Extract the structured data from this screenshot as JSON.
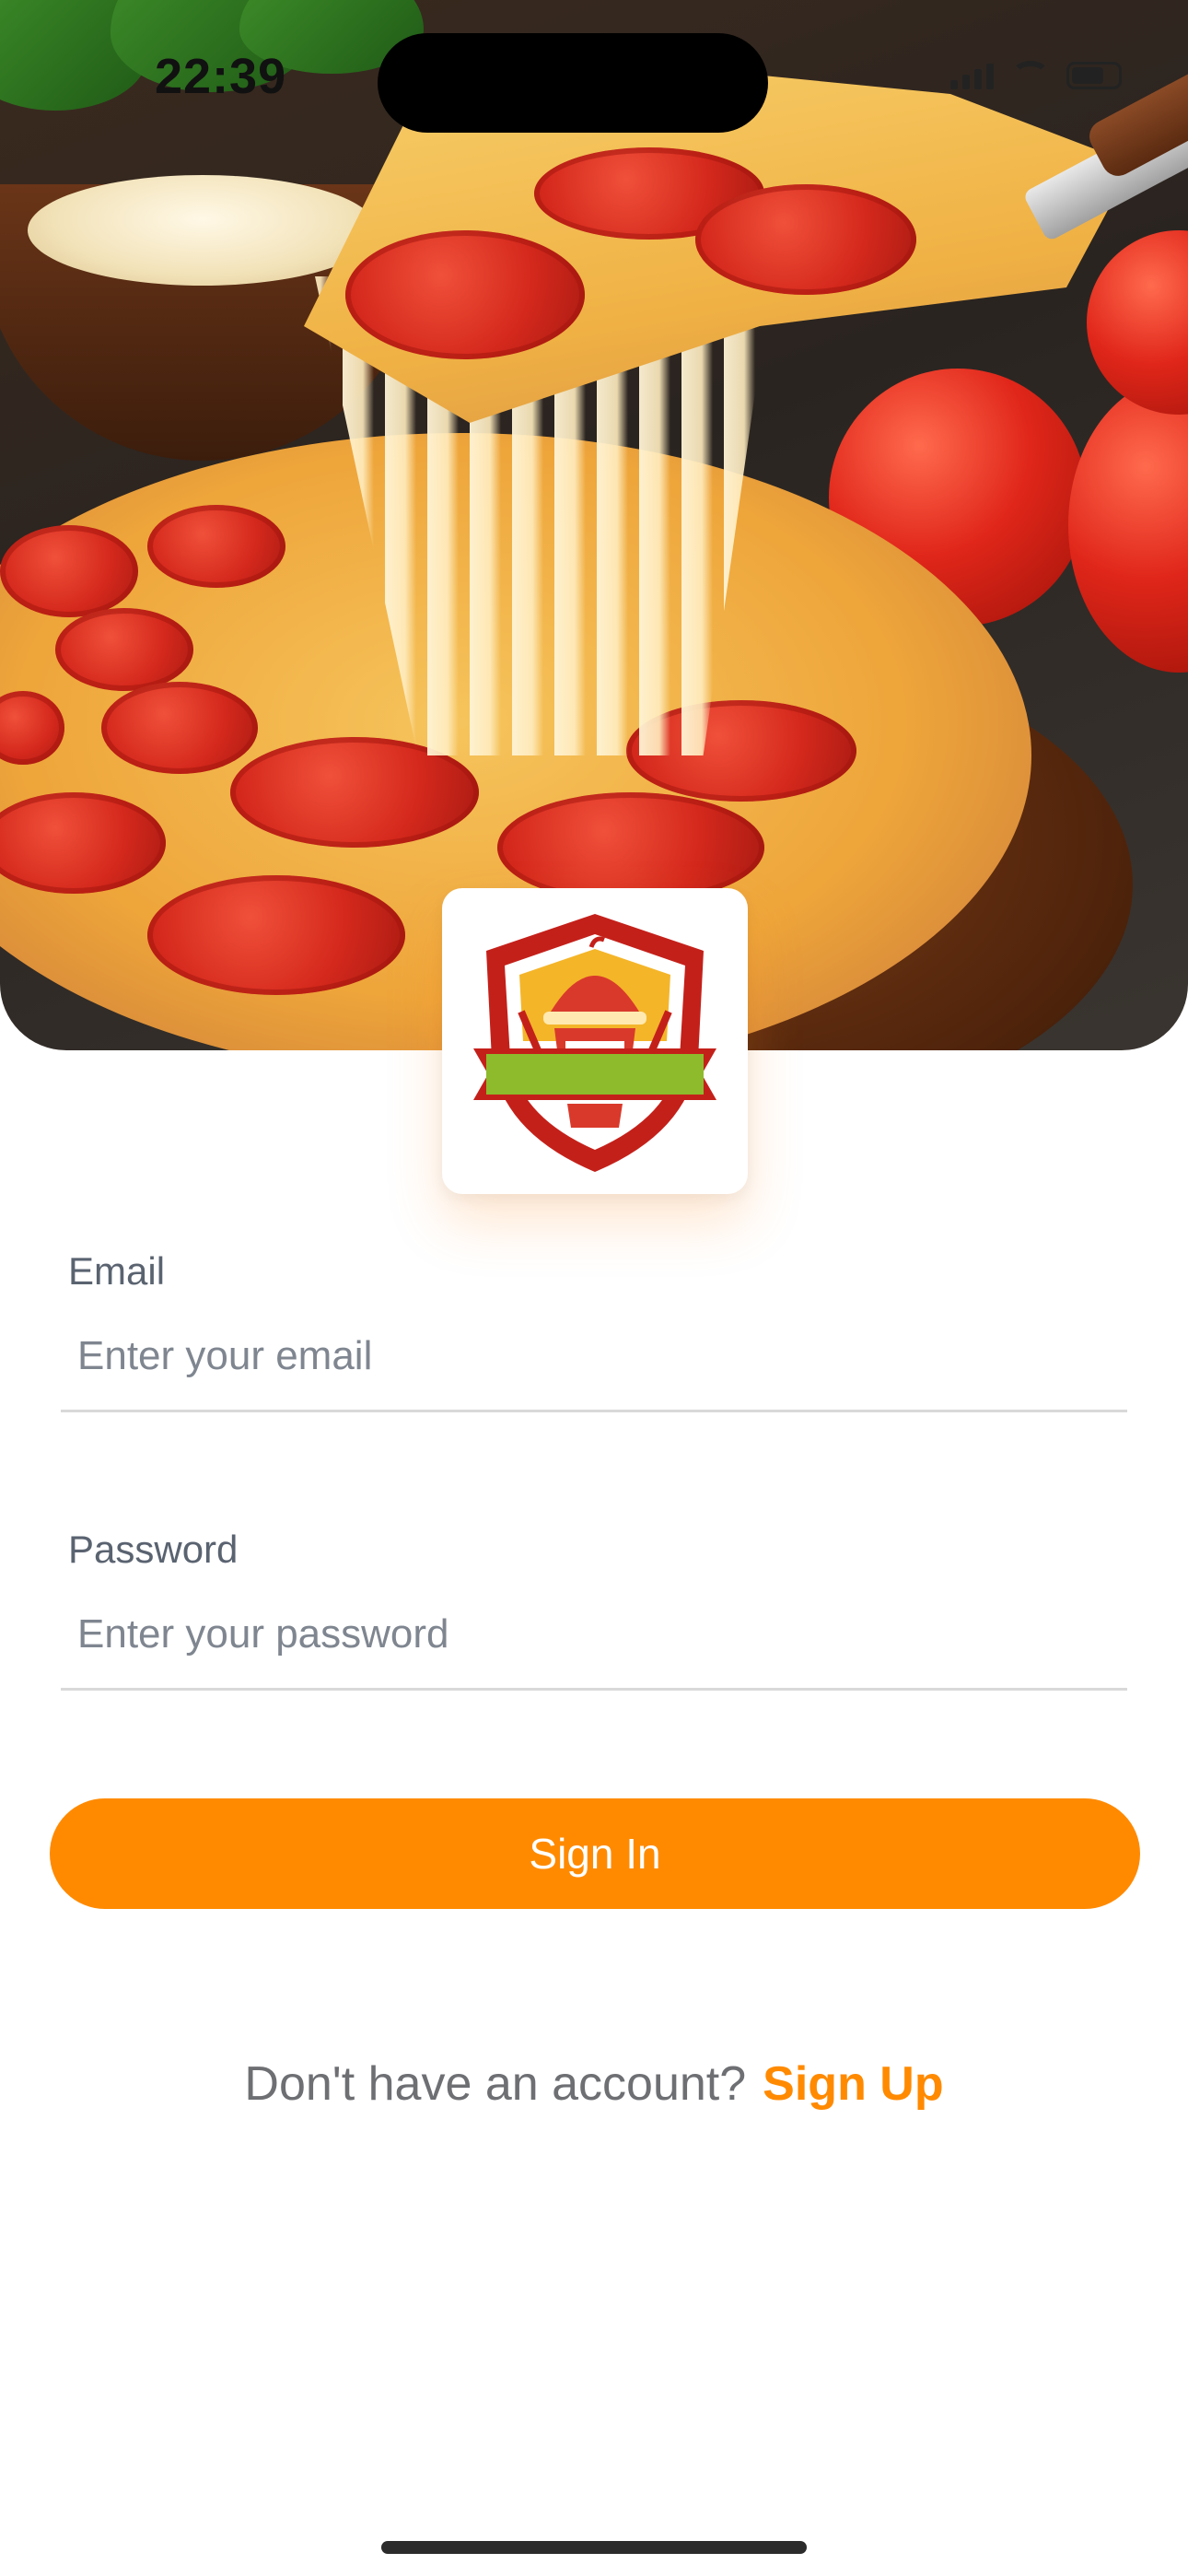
{
  "status_bar": {
    "time": "22:39"
  },
  "logo": {
    "name": "food-shield-logo-icon"
  },
  "form": {
    "email": {
      "label": "Email",
      "placeholder": "Enter your email"
    },
    "password": {
      "label": "Password",
      "placeholder": "Enter your password"
    },
    "submit_label": "Sign In"
  },
  "footer": {
    "prompt": "Don't have an account?",
    "signup_label": "Sign Up"
  },
  "colors": {
    "accent": "#ff8a00",
    "logo_red": "#c4201a",
    "logo_yellow": "#f4b529",
    "logo_green": "#8dbb2c"
  }
}
